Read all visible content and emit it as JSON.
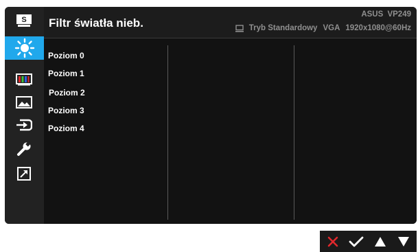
{
  "header": {
    "title": "Filtr światła nieb.",
    "model": "ASUS  VP249",
    "mode": "Tryb Standardowy",
    "input": "VGA",
    "resolution": "1920x1080@60Hz"
  },
  "sidebar": {
    "items": [
      {
        "icon": "splendid-icon",
        "active": false
      },
      {
        "icon": "blue-light-filter-icon",
        "active": true
      },
      {
        "icon": "color-icon",
        "active": false
      },
      {
        "icon": "image-icon",
        "active": false
      },
      {
        "icon": "input-select-icon",
        "active": false
      },
      {
        "icon": "system-setup-icon",
        "active": false
      },
      {
        "icon": "shortcut-icon",
        "active": false
      }
    ]
  },
  "options": [
    "Poziom 0",
    "Poziom 1",
    "Poziom 2",
    "Poziom 3",
    "Poziom 4"
  ],
  "keys": [
    {
      "icon": "close-icon",
      "color": "#e0282c"
    },
    {
      "icon": "check-icon",
      "color": "#ffffff"
    },
    {
      "icon": "up-arrow-icon",
      "color": "#ffffff"
    },
    {
      "icon": "down-arrow-icon",
      "color": "#ffffff"
    }
  ],
  "colors": {
    "accent": "#20a8ec",
    "panel": "#1a1a1a",
    "text_dim": "#8f8f8f"
  }
}
